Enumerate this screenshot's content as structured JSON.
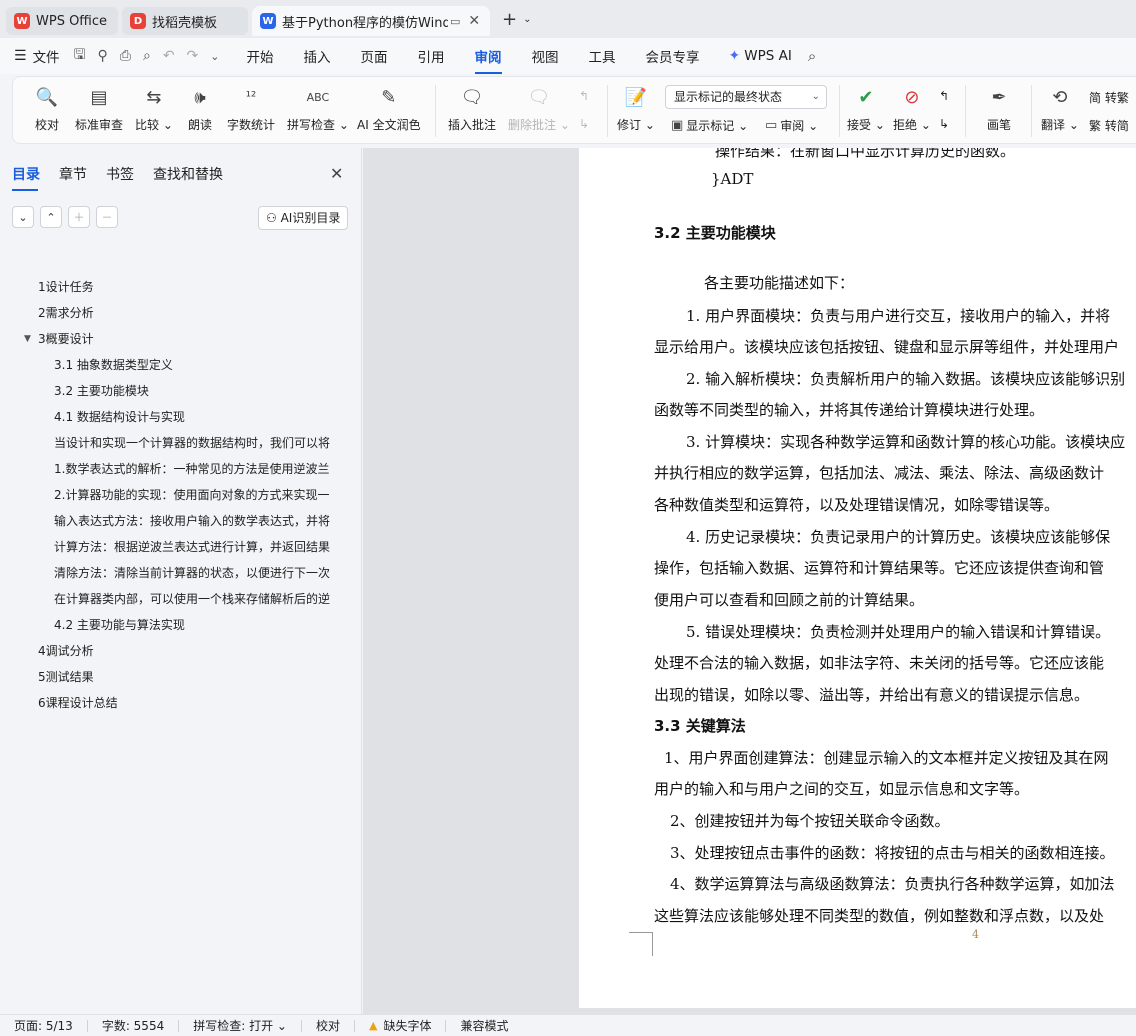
{
  "tabs": [
    {
      "label": "WPS Office",
      "logo": "W",
      "logo_color": "#e8413a",
      "state": "inactive"
    },
    {
      "label": "找稻壳模板",
      "logo": "D",
      "logo_color": "#e8413a",
      "state": "inactive"
    },
    {
      "label": "基于Python程序的模仿Windc",
      "logo": "W",
      "logo_color": "#2b66e8",
      "state": "active"
    }
  ],
  "menubar": {
    "file_label": "文件",
    "items": [
      "开始",
      "插入",
      "页面",
      "引用",
      "审阅",
      "视图",
      "工具",
      "会员专享"
    ],
    "active_item": "审阅",
    "wps_ai_label": "WPS AI"
  },
  "ribbon": {
    "buttons": [
      {
        "label": "校对",
        "icon": "proofread-icon",
        "enabled": true
      },
      {
        "label": "标准审查",
        "icon": "review-standard-icon",
        "enabled": true
      },
      {
        "label": "比较",
        "icon": "compare-icon",
        "enabled": true,
        "dropdown": true
      },
      {
        "label": "朗读",
        "icon": "read-aloud-icon",
        "enabled": true
      },
      {
        "label": "字数统计",
        "icon": "word-count-icon",
        "enabled": true
      },
      {
        "label": "拼写检查",
        "icon": "spell-check-icon",
        "enabled": true,
        "dropdown": true
      },
      {
        "label": "AI 全文润色",
        "icon": "ai-polish-icon",
        "enabled": true
      },
      {
        "label": "插入批注",
        "icon": "insert-comment-icon",
        "enabled": true
      },
      {
        "label": "删除批注",
        "icon": "delete-comment-icon",
        "enabled": false,
        "dropdown": true
      },
      {
        "label": "修订",
        "icon": "track-changes-icon",
        "enabled": true,
        "dropdown": true
      },
      {
        "label": "接受",
        "icon": "accept-icon",
        "enabled": true,
        "dropdown": true
      },
      {
        "label": "拒绝",
        "icon": "reject-icon",
        "enabled": true,
        "dropdown": true
      },
      {
        "label": "画笔",
        "icon": "pen-icon",
        "enabled": true
      },
      {
        "label": "翻译",
        "icon": "translate-icon",
        "enabled": true,
        "dropdown": true
      }
    ],
    "markup_select": "显示标记的最终状态",
    "show_markup_label": "显示标记",
    "review_label": "审阅",
    "to_traditional": "简 转繁",
    "to_simplified": "繁 转简"
  },
  "left_panel": {
    "tabs": [
      "目录",
      "章节",
      "书签",
      "查找和替换"
    ],
    "active_tab": "目录",
    "ai_toc_label": "AI识别目录",
    "toc": [
      {
        "text": "1设计任务",
        "level": 1
      },
      {
        "text": "2需求分析",
        "level": 1
      },
      {
        "text": "3概要设计",
        "level": 1,
        "expanded": true
      },
      {
        "text": "3.1 抽象数据类型定义",
        "level": 2
      },
      {
        "text": "3.2  主要功能模块",
        "level": 2
      },
      {
        "text": "4.1  数据结构设计与实现",
        "level": 2
      },
      {
        "text": "当设计和实现一个计算器的数据结构时，我们可以将",
        "level": 2
      },
      {
        "text": "1.数学表达式的解析：一种常见的方法是使用逆波兰",
        "level": 2
      },
      {
        "text": "2.计算器功能的实现：使用面向对象的方式来实现一",
        "level": 2
      },
      {
        "text": "输入表达式方法：接收用户输入的数学表达式，并将",
        "level": 2
      },
      {
        "text": "计算方法：根据逆波兰表达式进行计算，并返回结果",
        "level": 2
      },
      {
        "text": "清除方法：清除当前计算器的状态，以便进行下一次",
        "level": 2
      },
      {
        "text": "在计算器类内部，可以使用一个栈来存储解析后的逆",
        "level": 2
      },
      {
        "text": "4.2  主要功能与算法实现",
        "level": 2
      },
      {
        "text": "4调试分析",
        "level": 1
      },
      {
        "text": "5测试结果",
        "level": 1
      },
      {
        "text": "6课程设计总结",
        "level": 1
      }
    ]
  },
  "document": {
    "lines": [
      {
        "text": "操作结果：在新窗口中显示计算历史的函数。",
        "indent": 62,
        "kind": "p"
      },
      {
        "text": "}ADT",
        "indent": 58,
        "kind": "p"
      },
      {
        "text": "3.2  主要功能模块",
        "indent": 0,
        "kind": "h"
      },
      {
        "text": "各主要功能描述如下：",
        "indent": 50,
        "kind": "p"
      },
      {
        "text": "1. 用户界面模块：负责与用户进行交互，接收用户的输入，并将",
        "indent": 32,
        "kind": "p"
      },
      {
        "text": "显示给用户。该模块应该包括按钮、键盘和显示屏等组件，并处理用户",
        "indent": 0,
        "kind": "p"
      },
      {
        "text": "2. 输入解析模块：负责解析用户的输入数据。该模块应该能够识别",
        "indent": 32,
        "kind": "p"
      },
      {
        "text": "函数等不同类型的输入，并将其传递给计算模块进行处理。",
        "indent": 0,
        "kind": "p"
      },
      {
        "text": "3. 计算模块：实现各种数学运算和函数计算的核心功能。该模块应",
        "indent": 32,
        "kind": "p"
      },
      {
        "text": "并执行相应的数学运算，包括加法、减法、乘法、除法、高级函数计",
        "indent": 0,
        "kind": "p"
      },
      {
        "text": "各种数值类型和运算符，以及处理错误情况，如除零错误等。",
        "indent": 0,
        "kind": "p"
      },
      {
        "text": "4. 历史记录模块：负责记录用户的计算历史。该模块应该能够保",
        "indent": 32,
        "kind": "p"
      },
      {
        "text": "操作，包括输入数据、运算符和计算结果等。它还应该提供查询和管",
        "indent": 0,
        "kind": "p"
      },
      {
        "text": "便用户可以查看和回顾之前的计算结果。",
        "indent": 0,
        "kind": "p"
      },
      {
        "text": "5. 错误处理模块：负责检测并处理用户的输入错误和计算错误。",
        "indent": 32,
        "kind": "p"
      },
      {
        "text": "处理不合法的输入数据，如非法字符、未关闭的括号等。它还应该能",
        "indent": 0,
        "kind": "p"
      },
      {
        "text": "出现的错误，如除以零、溢出等，并给出有意义的错误提示信息。",
        "indent": 0,
        "kind": "p"
      },
      {
        "text": "3.3  关键算法",
        "indent": 0,
        "kind": "h"
      },
      {
        "text": "1、用户界面创建算法：创建显示输入的文本框并定义按钮及其在网",
        "indent": 10,
        "kind": "p"
      },
      {
        "text": "用户的输入和与用户之间的交互，如显示信息和文字等。",
        "indent": 0,
        "kind": "p"
      },
      {
        "text": "2、创建按钮并为每个按钮关联命令函数。",
        "indent": 16,
        "kind": "p"
      },
      {
        "text": "3、处理按钮点击事件的函数：将按钮的点击与相关的函数相连接。",
        "indent": 16,
        "kind": "p"
      },
      {
        "text": "4、数学运算算法与高级函数算法：负责执行各种数学运算，如加法",
        "indent": 16,
        "kind": "p"
      },
      {
        "text": "这些算法应该能够处理不同类型的数值，例如整数和浮点数，以及处",
        "indent": 0,
        "kind": "p"
      }
    ],
    "page_number": "4"
  },
  "statusbar": {
    "page": "页面: 5/13",
    "words": "字数: 5554",
    "spell": "拼写检查: 打开",
    "proofread": "校对",
    "missing_font": "缺失字体",
    "compat": "兼容模式"
  }
}
